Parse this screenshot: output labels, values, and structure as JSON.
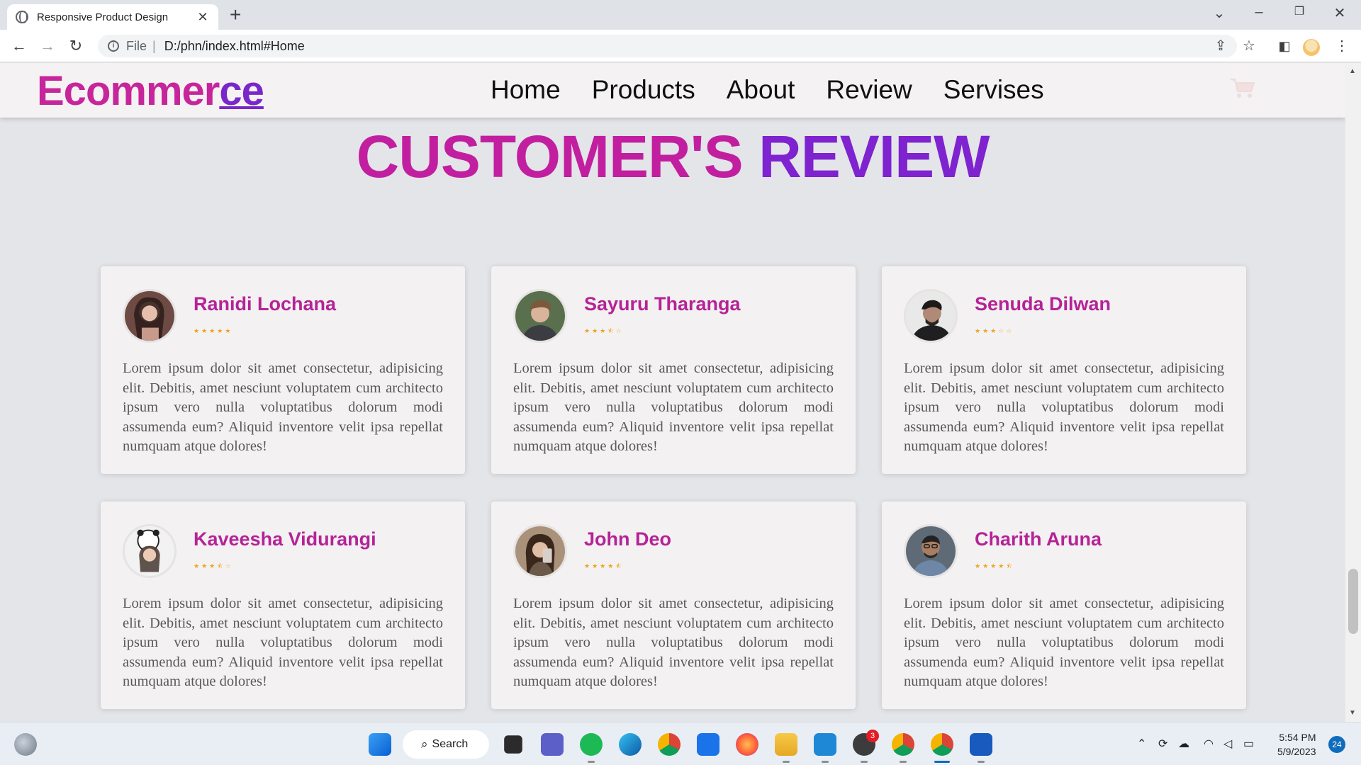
{
  "browser": {
    "tab_title": "Responsive Product Design",
    "omnibox_scheme": "File",
    "url": "D:/phn/index.html#Home"
  },
  "site": {
    "logo_main": "Ecommer",
    "logo_accent": "ce",
    "nav": [
      "Home",
      "Products",
      "About",
      "Review",
      "Servises"
    ],
    "section_title_part1": "CUSTOMER'S",
    "section_title_part2": "REVIEW"
  },
  "reviews": [
    {
      "name": "Ranidi Lochana",
      "rating": 5,
      "text": "Lorem ipsum dolor sit amet consectetur, adipisicing elit. Debitis, amet nesciunt voluptatem cum architecto ipsum vero nulla voluptatibus dolorum modi assumenda eum? Aliquid inventore velit ipsa repellat numquam atque dolores!"
    },
    {
      "name": "Sayuru Tharanga",
      "rating": 3.5,
      "text": "Lorem ipsum dolor sit amet consectetur, adipisicing elit. Debitis, amet nesciunt voluptatem cum architecto ipsum vero nulla voluptatibus dolorum modi assumenda eum? Aliquid inventore velit ipsa repellat numquam atque dolores!"
    },
    {
      "name": "Senuda Dilwan",
      "rating": 3,
      "text": "Lorem ipsum dolor sit amet consectetur, adipisicing elit. Debitis, amet nesciunt voluptatem cum architecto ipsum vero nulla voluptatibus dolorum modi assumenda eum? Aliquid inventore velit ipsa repellat numquam atque dolores!"
    },
    {
      "name": "Kaveesha Vidurangi",
      "rating": 3.5,
      "text": "Lorem ipsum dolor sit amet consectetur, adipisicing elit. Debitis, amet nesciunt voluptatem cum architecto ipsum vero nulla voluptatibus dolorum modi assumenda eum? Aliquid inventore velit ipsa repellat numquam atque dolores!"
    },
    {
      "name": "John Deo",
      "rating": 4.5,
      "text": "Lorem ipsum dolor sit amet consectetur, adipisicing elit. Debitis, amet nesciunt voluptatem cum architecto ipsum vero nulla voluptatibus dolorum modi assumenda eum? Aliquid inventore velit ipsa repellat numquam atque dolores!"
    },
    {
      "name": "Charith Aruna",
      "rating": 4.5,
      "text": "Lorem ipsum dolor sit amet consectetur, adipisicing elit. Debitis, amet nesciunt voluptatem cum architecto ipsum vero nulla voluptatibus dolorum modi assumenda eum? Aliquid inventore velit ipsa repellat numquam atque dolores!"
    }
  ],
  "taskbar": {
    "search_label": "Search",
    "whatsapp_badge": "3",
    "time": "5:54 PM",
    "date": "5/9/2023",
    "notifications": "24"
  },
  "colors": {
    "brand_pink": "#c7259b",
    "brand_purple": "#7a27c9",
    "star": "#f0a21b"
  }
}
